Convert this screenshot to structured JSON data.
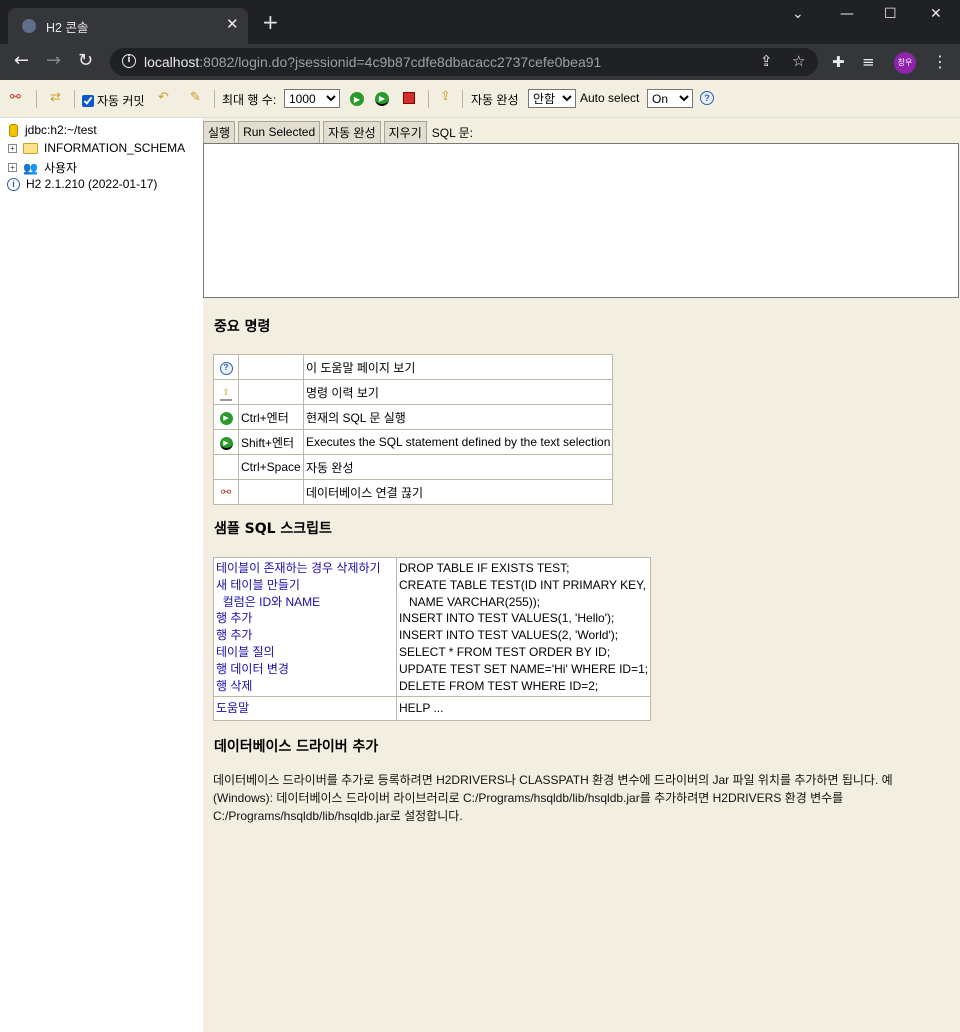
{
  "browser": {
    "tab_title": "H2 콘솔",
    "url_host": "localhost",
    "url_rest": ":8082/login.do?jsessionid=4c9b87cdfe8dbacacc2737cefe0bea91",
    "profile_initials": "창우"
  },
  "toolbar": {
    "autocommit_label": "자동 커밋",
    "autocommit_checked": true,
    "maxrows_label": "최대 행 수:",
    "maxrows_value": "1000",
    "autocomplete_label": "자동 완성",
    "autocomplete_value": "안함",
    "autoselect_label": "Auto select",
    "autoselect_value": "On"
  },
  "tree": {
    "connection": "jdbc:h2:~/test",
    "schema": "INFORMATION_SCHEMA",
    "users": "사용자",
    "version": "H2 2.1.210 (2022-01-17)"
  },
  "query": {
    "execute_label": "실행",
    "run_selected_label": "Run Selected",
    "autocomplete_label": "자동 완성",
    "clear_label": "지우기",
    "sql_label": "SQL 문:",
    "sql_text": ""
  },
  "important": {
    "heading": "중요 명령",
    "rows": [
      {
        "icon": "help-icon",
        "key": "",
        "desc": "이 도움말 페이지 보기"
      },
      {
        "icon": "history-icon",
        "key": "",
        "desc": "명령 이력 보기"
      },
      {
        "icon": "run-icon",
        "key": "Ctrl+엔터",
        "desc": "현재의 SQL 문 실행"
      },
      {
        "icon": "run-selected-icon",
        "key": "Shift+엔터",
        "desc": "Executes the SQL statement defined by the text selection"
      },
      {
        "icon": "",
        "key": "Ctrl+Space",
        "desc": "자동 완성"
      },
      {
        "icon": "disconnect-icon",
        "key": "",
        "desc": "데이터베이스 연결 끊기"
      }
    ]
  },
  "samples": {
    "heading": "샘플 SQL 스크립트",
    "links": [
      "테이블이 존재하는 경우 삭제하기",
      "새 테이블 만들기",
      "  컬럼은 ID와 NAME",
      "행 추가",
      "행 추가",
      "테이블 질의",
      "행 데이터 변경",
      "행 삭제"
    ],
    "code": [
      "DROP TABLE IF EXISTS TEST;",
      "CREATE TABLE TEST(ID INT PRIMARY KEY,",
      "   NAME VARCHAR(255));",
      "INSERT INTO TEST VALUES(1, 'Hello');",
      "INSERT INTO TEST VALUES(2, 'World');",
      "SELECT * FROM TEST ORDER BY ID;",
      "UPDATE TEST SET NAME='Hi' WHERE ID=1;",
      "DELETE FROM TEST WHERE ID=2;"
    ],
    "help_link": "도움말",
    "help_code": "HELP ..."
  },
  "driver": {
    "heading": "데이터베이스 드라이버 추가",
    "text": "데이터베이스 드라이버를 추가로 등록하려면 H2DRIVERS나 CLASSPATH 환경 변수에 드라이버의 Jar 파일 위치를 추가하면 됩니다. 예 (Windows): 데이터베이스 드라이버 라이브러리로 C:/Programs/hsqldb/lib/hsqldb.jar를 추가하려면 H2DRIVERS 환경 변수를 C:/Programs/hsqldb/lib/hsqldb.jar로 설정합니다."
  },
  "colors": {
    "content_bg": "#f2eee0",
    "link": "#1a0dab",
    "run_green": "#2a9a2a",
    "stop_red": "#d32f2f"
  }
}
